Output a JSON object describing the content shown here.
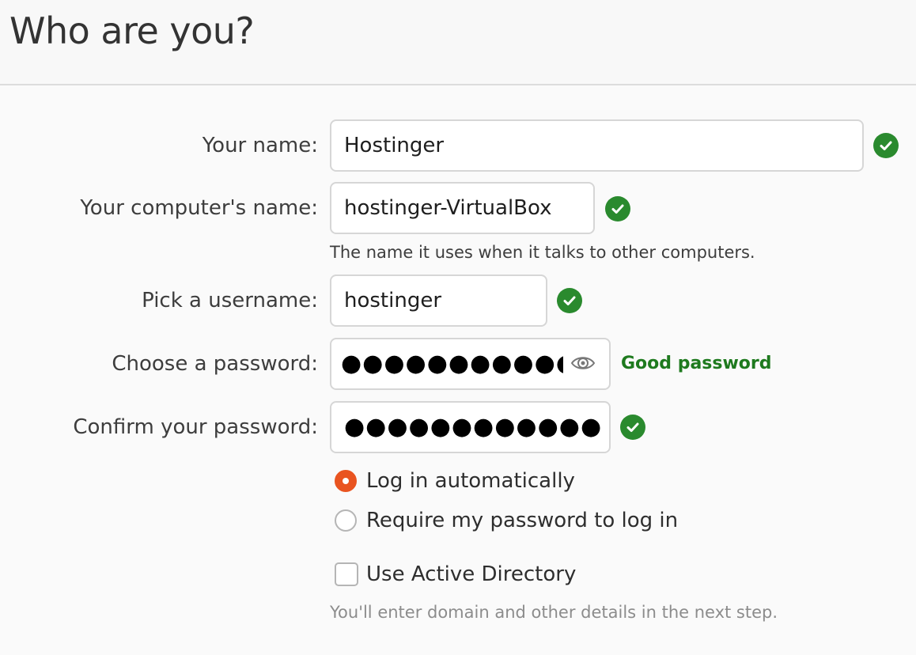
{
  "page": {
    "title": "Who are you?"
  },
  "form": {
    "name": {
      "label": "Your name:",
      "value": "Hostinger",
      "status_icon": "check-circle-icon"
    },
    "computer_name": {
      "label": "Your computer's name:",
      "value": "hostinger-VirtualBox",
      "hint": "The name it uses when it talks to other computers.",
      "status_icon": "check-circle-icon"
    },
    "username": {
      "label": "Pick a username:",
      "value": "hostinger",
      "status_icon": "check-circle-icon"
    },
    "password": {
      "label": "Choose a password:",
      "masked_value": "●●●●●●●●●●●●",
      "reveal_icon": "eye-icon",
      "strength": "Good password"
    },
    "confirm_password": {
      "label": "Confirm your password:",
      "masked_value": "●●●●●●●●●●●●",
      "status_icon": "check-circle-icon"
    },
    "login_options": [
      {
        "label": "Log in automatically",
        "selected": true
      },
      {
        "label": "Require my password to log in",
        "selected": false
      }
    ],
    "active_directory": {
      "label": "Use Active Directory",
      "checked": false,
      "hint": "You'll enter domain and other details in the next step."
    }
  },
  "colors": {
    "accent": "#e95420",
    "success": "#2a8a2e",
    "strength_text": "#1e7a1e"
  }
}
